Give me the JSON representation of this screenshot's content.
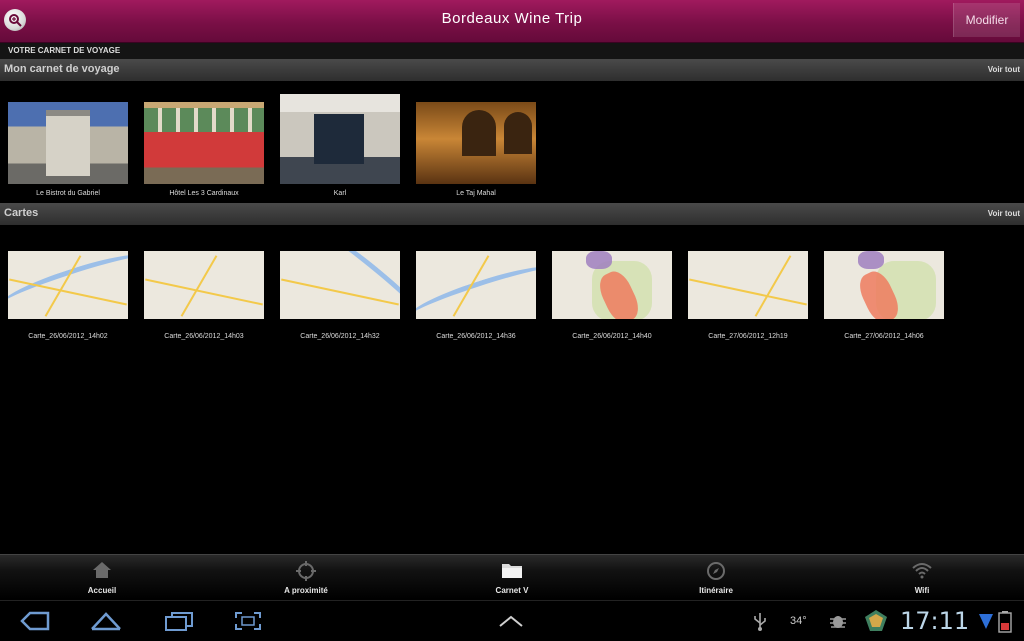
{
  "header": {
    "title": "Bordeaux Wine Trip",
    "edit_label": "Modifier"
  },
  "breadcrumb": "VOTRE CARNET DE VOYAGE",
  "sections": {
    "carnet": {
      "title": "Mon carnet de voyage",
      "see_all": "Voir tout",
      "items": [
        {
          "label": "Le Bistrot du Gabriel"
        },
        {
          "label": "Hôtel Les 3 Cardinaux"
        },
        {
          "label": "Karl"
        },
        {
          "label": "Le Taj Mahal"
        }
      ]
    },
    "cartes": {
      "title": "Cartes",
      "see_all": "Voir tout",
      "items": [
        {
          "label": "Carte_26/06/2012_14h02"
        },
        {
          "label": "Carte_26/06/2012_14h03"
        },
        {
          "label": "Carte_26/06/2012_14h32"
        },
        {
          "label": "Carte_26/06/2012_14h36"
        },
        {
          "label": "Carte_26/06/2012_14h40"
        },
        {
          "label": "Carte_27/06/2012_12h19"
        },
        {
          "label": "Carte_27/06/2012_14h06"
        }
      ]
    }
  },
  "tabs": [
    {
      "label": "Accueil",
      "icon": "home-icon"
    },
    {
      "label": "A proximité",
      "icon": "target-icon"
    },
    {
      "label": "Carnet V",
      "icon": "folder-icon"
    },
    {
      "label": "Itinéraire",
      "icon": "compass-icon"
    },
    {
      "label": "Wifi",
      "icon": "wifi-icon"
    }
  ],
  "system": {
    "temperature": "34°",
    "time": "17:11"
  },
  "colors": {
    "header_top": "#a01a5e",
    "header_bottom": "#650a3a",
    "clock": "#bcd6e8"
  }
}
